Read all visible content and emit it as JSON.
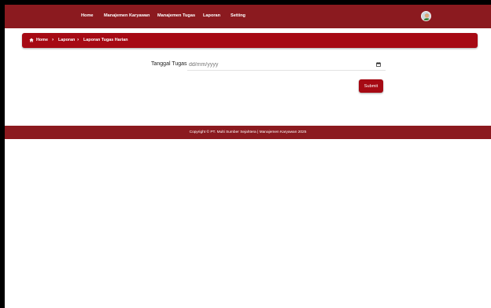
{
  "navbar": {
    "items": [
      {
        "label": "Home"
      },
      {
        "label": "Manajemen Karyawan"
      },
      {
        "label": "Manajemen Tugas"
      },
      {
        "label": "Laporan"
      },
      {
        "label": "Setting"
      }
    ],
    "avatar": "user-avatar"
  },
  "breadcrumb": {
    "items": [
      {
        "label": "Home",
        "icon": "home-icon"
      },
      {
        "label": "Laporan"
      },
      {
        "label": "Laporan Tugas Harian"
      }
    ],
    "separator": "›"
  },
  "form": {
    "label": "Tanggal Tugas :",
    "date_placeholder": "dd/mm/yyyy",
    "calendar_icon": "calendar-icon",
    "submit_label": "Submit"
  },
  "footer": {
    "text": "Copyright © PT. Multi Sumber Sejahtera | Manajemen Karyawan 2025"
  },
  "colors": {
    "navbar": "#8b1a1f",
    "breadcrumb": "#a60a14",
    "button": "#a60a14",
    "footer": "#8b1a1f"
  }
}
